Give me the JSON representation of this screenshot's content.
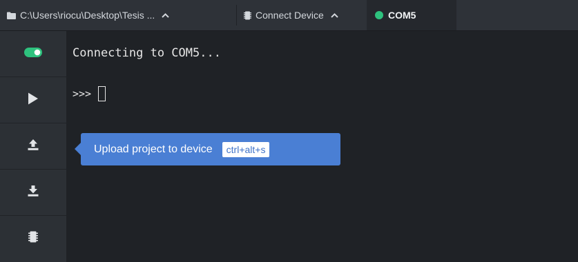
{
  "status_bar": {
    "path_label": "C:\\Users\\riocu\\Desktop\\Tesis ...",
    "device_label": "Connect Device",
    "port_label": "COM5",
    "port_status_color": "#2ec27e",
    "icons": [
      "folder-icon",
      "chevron-up-icon",
      "chip-icon",
      "chevron-up-icon",
      "connected-dot-icon"
    ]
  },
  "toolbar": {
    "items": [
      {
        "name": "connect-toggle",
        "icon": "toggle-on-icon",
        "accent": "#2ec27e"
      },
      {
        "name": "run",
        "icon": "play-icon"
      },
      {
        "name": "upload",
        "icon": "upload-icon"
      },
      {
        "name": "download",
        "icon": "download-icon"
      },
      {
        "name": "device",
        "icon": "chip-icon"
      }
    ]
  },
  "terminal": {
    "message": "Connecting to COM5...",
    "prompt": ">>>"
  },
  "tooltip": {
    "text": "Upload project to device",
    "shortcut": "ctrl+alt+s",
    "color": "#4a7fd4"
  }
}
